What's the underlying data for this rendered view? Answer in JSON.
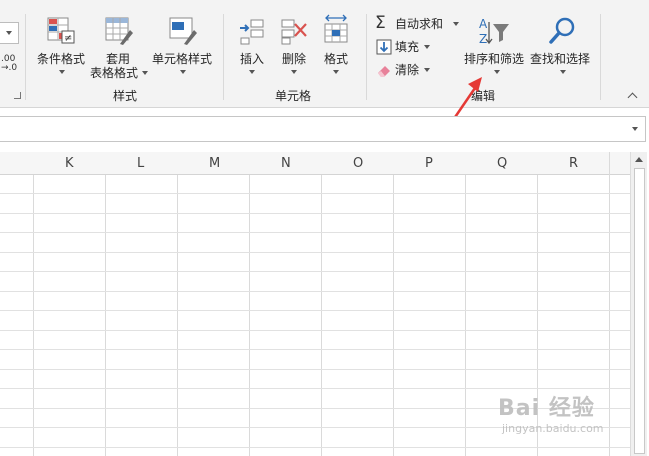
{
  "ribbon": {
    "styles_group": {
      "conditional_formatting": "条件格式",
      "format_as_table_line1": "套用",
      "format_as_table_line2": "表格格式",
      "cell_styles": "单元格样式",
      "group_label": "样式"
    },
    "cells_group": {
      "insert": "插入",
      "delete": "删除",
      "format": "格式",
      "group_label": "单元格"
    },
    "editing_group": {
      "autosum": "自动求和",
      "fill": "填充",
      "clear": "清除",
      "sort_filter": "排序和筛选",
      "find_select": "查找和选择",
      "group_label": "编辑"
    },
    "number_format_glyph": ".00\n→.0"
  },
  "columns": [
    "K",
    "L",
    "M",
    "N",
    "O",
    "P",
    "Q",
    "R"
  ],
  "watermark": {
    "brand": "Bai 经验",
    "url": "jingyan.baidu.com"
  },
  "colors": {
    "arrow": "#e53935",
    "accent_blue": "#2f6fb7",
    "ribbon_bg": "#f3f3f3"
  }
}
